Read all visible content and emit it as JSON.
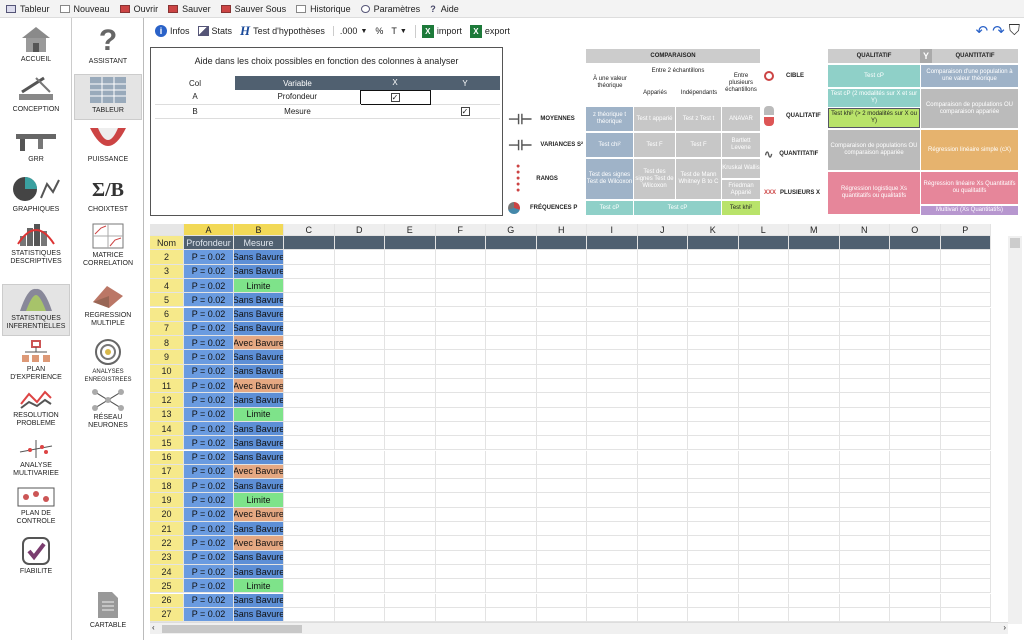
{
  "menu": [
    {
      "label": "Tableur"
    },
    {
      "label": "Nouveau"
    },
    {
      "label": "Ouvrir"
    },
    {
      "label": "Sauver"
    },
    {
      "label": "Sauver Sous"
    },
    {
      "label": "Historique"
    },
    {
      "label": "Paramètres"
    },
    {
      "label": "Aide"
    }
  ],
  "nav_left": [
    {
      "label": "ACCUEIL"
    },
    {
      "label": "CONCEPTION"
    },
    {
      "label": "GRR"
    },
    {
      "label": "GRAPHIQUES"
    },
    {
      "label": "STATISTIQUES DESCRIPTIVES"
    },
    {
      "label": "STATISTIQUES INFERENTIELLES"
    },
    {
      "label": "PLAN D'EXPERIENCE"
    },
    {
      "label": "RESOLUTION PROBLEME"
    },
    {
      "label": "ANALYSE MULTIVARIEE"
    },
    {
      "label": "PLAN DE CONTROLE"
    },
    {
      "label": "FIABILITE"
    }
  ],
  "nav_right": [
    {
      "label": "ASSISTANT"
    },
    {
      "label": "TABLEUR"
    },
    {
      "label": "PUISSANCE"
    },
    {
      "label": "CHOIXTEST"
    },
    {
      "label": "MATRICE CORRELATION"
    },
    {
      "label": "REGRESSION MULTIPLE"
    },
    {
      "label": "ANALYSES ENREGISTREES"
    },
    {
      "label": "RÉSEAU NEURONES"
    }
  ],
  "cartable": "CARTABLE",
  "toolbar": {
    "infos": "Infos",
    "stats": "Stats",
    "test": "Test d'hypothèses",
    "format": ".000",
    "percent": "%",
    "font": "T",
    "import": "import",
    "export": "export"
  },
  "colpanel": {
    "title": "Aide dans les choix possibles en fonction des colonnes à analyser",
    "headers": [
      "Col",
      "Variable",
      "X",
      "Y"
    ],
    "rows": [
      {
        "col": "A",
        "variable": "Profondeur",
        "x": true,
        "y": false
      },
      {
        "col": "B",
        "variable": "Mesure",
        "x": false,
        "y": true
      }
    ]
  },
  "guide": {
    "comparaison": "COMPARAISON",
    "a_valeur": "À une valeur théorique",
    "entre2": "Entre 2 échantillons",
    "apparies": "Appariés",
    "independants": "Indépendants",
    "entre_plusieurs": "Entre plusieurs échantillons",
    "moyennes": "MOYENNES",
    "variances": "VARIANCES S²",
    "rangs": "RANGS",
    "frequences": "FRÉQUENCES P",
    "c_moy": [
      "z théorique t théorique",
      "Test t apparié",
      "Test z Test t",
      "ANAVAR"
    ],
    "c_var": [
      "Test chi²",
      "Test F",
      "Test F",
      "Bartlett Levene"
    ],
    "c_rang": [
      "Test des signes Test de Wilcoxon",
      "Test des signes Test de Wilcoxon",
      "Test de Mann Whitney B to C",
      "Kruskal Wallis",
      "Friedman Apparié"
    ],
    "c_freq": [
      "Test cP",
      "Test cP",
      "Test khi²"
    ],
    "qualitatif_h": "QUALITATIF",
    "quantitatif_h": "QUANTITATIF",
    "cible": "CIBLE",
    "qualitatif": "QUALITATIF",
    "quantitatif": "QUANTITATIF",
    "plusieurs": "PLUSIEURS X",
    "q_cible": [
      "Test cP",
      "Comparaison d'une population à une valeur théorique"
    ],
    "q_qual": [
      "Test cP (2 modalités sur X et sur Y)",
      "Test khi² (> 2 modalités sur X ou Y)",
      "Comparaison de populations OU comparaison appariée"
    ],
    "q_quant": [
      "Comparaison de populations OU comparaison appariée",
      "Régression linéaire simple (cX)"
    ],
    "q_plus": [
      "Régression logistique Xs quantitatifs ou qualitatifs",
      "Régression linéaire Xs Quantitatifs ou qualitatifs",
      "Multivari (Xs Quantitatifs)"
    ]
  },
  "sheet": {
    "columns": [
      "A",
      "B",
      "C",
      "D",
      "E",
      "F",
      "G",
      "H",
      "I",
      "J",
      "K",
      "L",
      "M",
      "N",
      "O",
      "P"
    ],
    "row_label": "Nom",
    "col_names": [
      "Profondeur",
      "Mesure"
    ],
    "rows": [
      {
        "n": "2",
        "a": "P = 0.02",
        "b": "Sans Bavure"
      },
      {
        "n": "3",
        "a": "P = 0.02",
        "b": "Sans Bavure"
      },
      {
        "n": "4",
        "a": "P = 0.02",
        "b": "Limite"
      },
      {
        "n": "5",
        "a": "P = 0.02",
        "b": "Sans Bavure"
      },
      {
        "n": "6",
        "a": "P = 0.02",
        "b": "Sans Bavure"
      },
      {
        "n": "7",
        "a": "P = 0.02",
        "b": "Sans Bavure"
      },
      {
        "n": "8",
        "a": "P = 0.02",
        "b": "Avec Bavure"
      },
      {
        "n": "9",
        "a": "P = 0.02",
        "b": "Sans Bavure"
      },
      {
        "n": "10",
        "a": "P = 0.02",
        "b": "Sans Bavure"
      },
      {
        "n": "11",
        "a": "P = 0.02",
        "b": "Avec Bavure"
      },
      {
        "n": "12",
        "a": "P = 0.02",
        "b": "Sans Bavure"
      },
      {
        "n": "13",
        "a": "P = 0.02",
        "b": "Limite"
      },
      {
        "n": "14",
        "a": "P = 0.02",
        "b": "Sans Bavure"
      },
      {
        "n": "15",
        "a": "P = 0.02",
        "b": "Sans Bavure"
      },
      {
        "n": "16",
        "a": "P = 0.02",
        "b": "Sans Bavure"
      },
      {
        "n": "17",
        "a": "P = 0.02",
        "b": "Avec Bavure"
      },
      {
        "n": "18",
        "a": "P = 0.02",
        "b": "Sans Bavure"
      },
      {
        "n": "19",
        "a": "P = 0.02",
        "b": "Limite"
      },
      {
        "n": "20",
        "a": "P = 0.02",
        "b": "Avec Bavure"
      },
      {
        "n": "21",
        "a": "P = 0.02",
        "b": "Sans Bavure"
      },
      {
        "n": "22",
        "a": "P = 0.02",
        "b": "Avec Bavure"
      },
      {
        "n": "23",
        "a": "P = 0.02",
        "b": "Sans Bavure"
      },
      {
        "n": "24",
        "a": "P = 0.02",
        "b": "Sans Bavure"
      },
      {
        "n": "25",
        "a": "P = 0.02",
        "b": "Limite"
      },
      {
        "n": "26",
        "a": "P = 0.02",
        "b": "Sans Bavure"
      },
      {
        "n": "27",
        "a": "P = 0.02",
        "b": "Sans Bavure"
      }
    ]
  },
  "colors": {
    "sans": "#5d8fd6",
    "avec": "#e5a882",
    "limite": "#7ee38a",
    "a_col": "#6a9be0",
    "rowhdr": "#f6e98a",
    "colhdr_sel": "#f2d957"
  }
}
